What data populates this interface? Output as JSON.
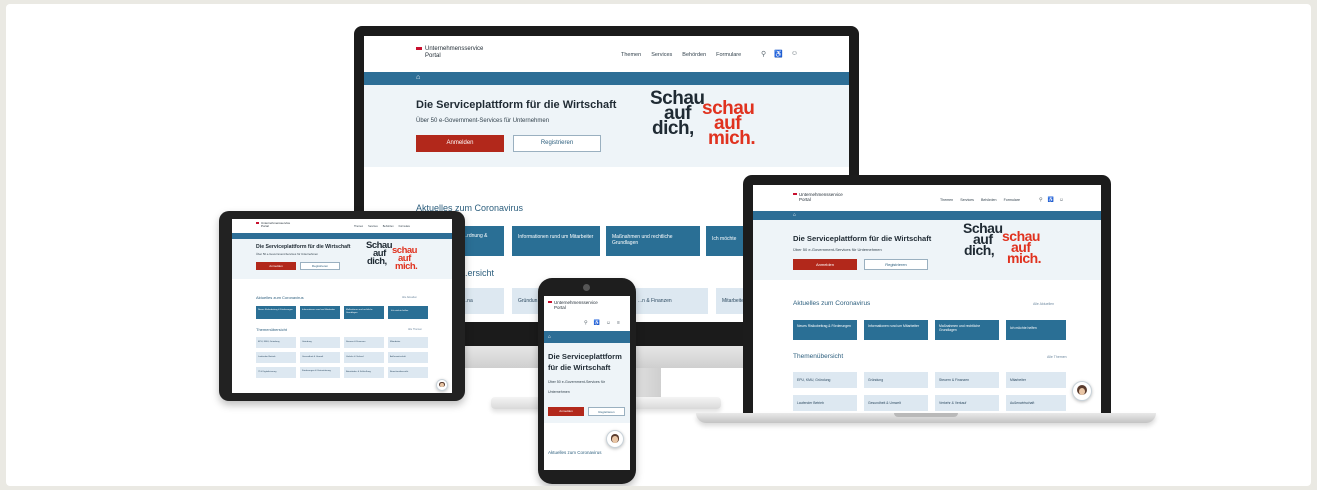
{
  "logo": {
    "line1": "Unternehmensservice",
    "line2": "Portal"
  },
  "nav": {
    "items": [
      "Themen",
      "Services",
      "Behörden",
      "Formulare"
    ]
  },
  "hero": {
    "title": "Die Serviceplattform für die Wirtschaft",
    "title_mobile_l1": "Die Serviceplattform",
    "title_mobile_l2": "für die Wirtschaft",
    "subtitle": "Über 50 e-Government-Services für Unternehmen",
    "subtitle_mobile_l1": "Über 50 e-Government-Services für",
    "subtitle_mobile_l2": "Unternehmen",
    "login_label": "Anmelden",
    "register_label": "Registrieren"
  },
  "slogan": {
    "w1": "Schau",
    "w2": "auf",
    "w3": "dich,",
    "r1": "schau",
    "r2": "auf",
    "r3": "mich."
  },
  "corona": {
    "heading": "Aktuelles zum Coronavirus",
    "more": "Alle Aktuellen",
    "tiles": [
      "Neues Risikobeitrag & Förderungen",
      "Informationen rund um Mitarbeiter",
      "Maßnahmen und rechtliche Grundlagen",
      "Ich möchte helfen"
    ],
    "desktop_tiles": [
      "...rdnung &",
      "Informationen rund um Mitarbeiter",
      "Maßnahmen und rechtliche Grundlagen",
      "Ich möchte"
    ]
  },
  "themen": {
    "heading": "Themenübersicht",
    "heading_partial": "...ersicht",
    "more": "Alle Themen",
    "tiles": [
      "EPU, KMU, Gründung",
      "Gründung",
      "Steuern & Finanzen",
      "Mitarbeiter",
      "Laufender Betrieb",
      "Gesundheit & Umwelt",
      "Verkehr & Verkauf",
      "Außenwirtschaft",
      "IT & Digitalisierung",
      "Förderungen & Unterstützung",
      "Betriebsbe- & Schließung",
      "Branchenübersicht"
    ],
    "desktop_tiles": [
      "...na",
      "Gründun...",
      "...n & Finanzen",
      "Mitarbeiter"
    ]
  }
}
